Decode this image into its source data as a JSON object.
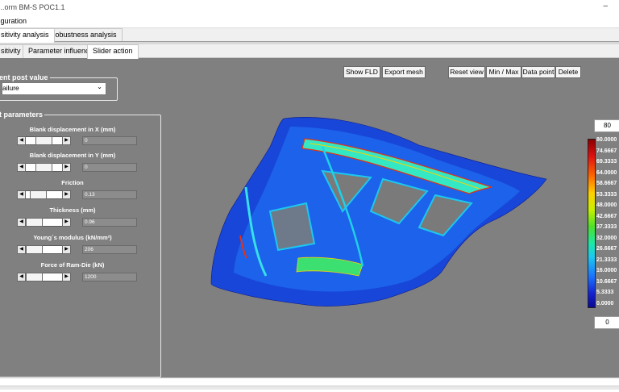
{
  "window": {
    "title": "...orm BM-S POC1.1",
    "minimize": "–"
  },
  "menu": {
    "configuration": "figuration"
  },
  "tabs_main": [
    {
      "label": "sitivity analysis"
    },
    {
      "label": "Robustness analysis"
    }
  ],
  "tabs_sub": [
    {
      "label": "sitivity"
    },
    {
      "label": "Parameter influences"
    },
    {
      "label": "Slider action"
    }
  ],
  "toolbar": {
    "show_fld": "Show FLD",
    "export_mesh": "Export mesh",
    "reset_view": "Reset view",
    "min_max": "Min / Max",
    "data_point": "Data point",
    "delete": "Delete"
  },
  "post_value": {
    "group_label": "ent post value",
    "selected": "ailure"
  },
  "parameters": {
    "group_label": "t parameters",
    "items": [
      {
        "label": "Blank displacement in X (mm)",
        "value": "0",
        "level": 0.48
      },
      {
        "label": "Blank displacement in Y (mm)",
        "value": "0",
        "level": 0.48
      },
      {
        "label": "Friction",
        "value": "0.13",
        "level": 0.2
      },
      {
        "label": "Thickness (mm)",
        "value": "0.96",
        "level": 0.02
      },
      {
        "label": "Young´s modulus (kN/mm²)",
        "value": "206",
        "level": 0.02
      },
      {
        "label": "Force of Ram-Die (kN)",
        "value": "1200",
        "level": 0.02
      }
    ]
  },
  "colorbar": {
    "max_box": "80",
    "min_box": "0",
    "labels": [
      "80.0000",
      "74.6667",
      "69.3333",
      "64.0000",
      "58.6667",
      "53.3333",
      "48.0000",
      "42.6667",
      "37.3333",
      "32.0000",
      "26.6667",
      "21.3333",
      "16.0000",
      "10.6667",
      "5.3333",
      "0.0000"
    ]
  },
  "colors": {
    "viewport": "#808080"
  }
}
